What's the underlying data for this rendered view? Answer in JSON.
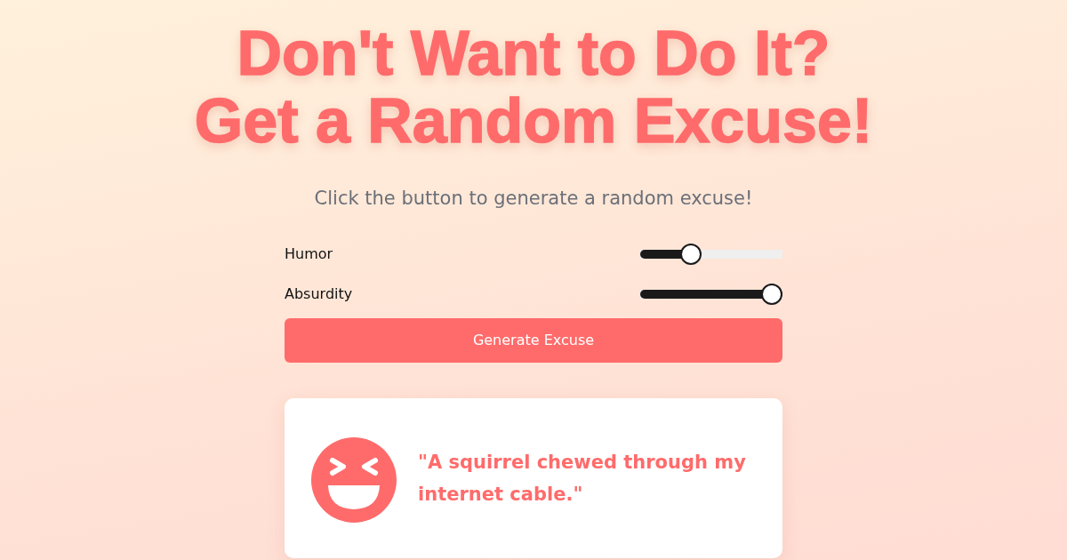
{
  "title_lines": [
    "Don't Want to Do It?",
    "Get a Random Excuse!"
  ],
  "subtitle": "Click the button to generate a random excuse!",
  "sliders": [
    {
      "label": "Humor",
      "level": 0.33
    },
    {
      "label": "Absurdity",
      "level": 1.0
    }
  ],
  "button": "Generate Excuse",
  "excuse": {
    "text": "\"A squirrel chewed through my internet cable.\""
  }
}
